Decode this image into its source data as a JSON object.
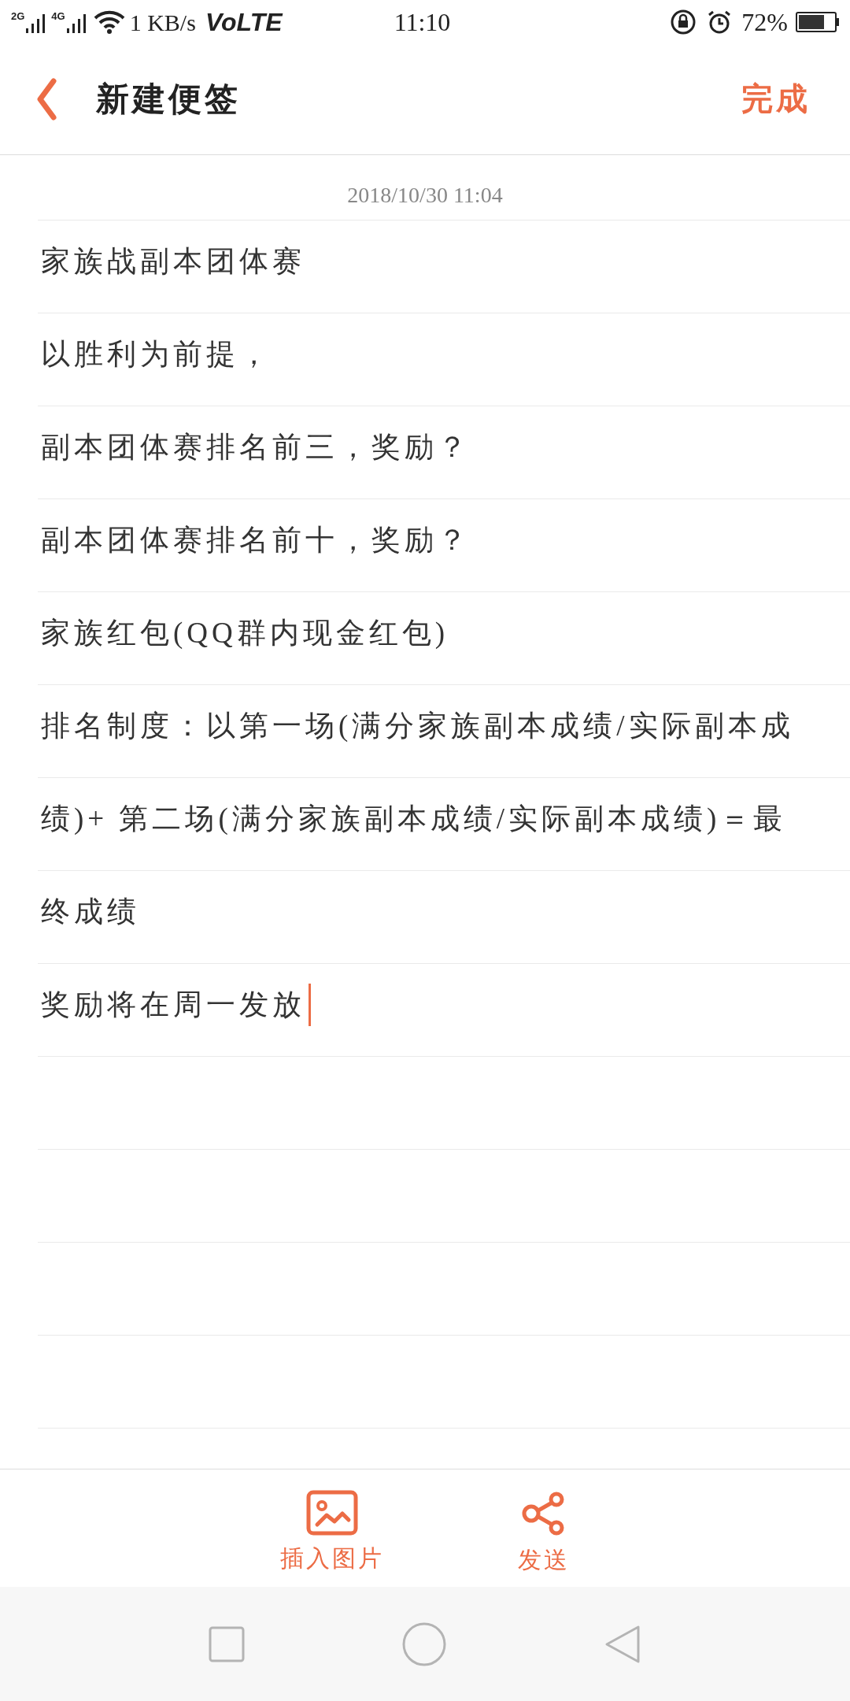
{
  "status_bar": {
    "network_1": "2G",
    "network_2": "4G",
    "speed": "1 KB/s",
    "volte": "VoLTE",
    "time": "11:10",
    "battery": "72%"
  },
  "header": {
    "title": "新建便签",
    "done": "完成"
  },
  "note": {
    "date": "2018/10/30 11:04",
    "lines": [
      {
        "text": "家族战副本团体赛",
        "cursor": false
      },
      {
        "text": "以胜利为前提，",
        "cursor": false
      },
      {
        "text": "副本团体赛排名前三，奖励？",
        "cursor": false
      },
      {
        "text": "副本团体赛排名前十，奖励？",
        "cursor": false
      },
      {
        "text": "家族红包(QQ群内现金红包)",
        "cursor": false
      },
      {
        "text": "排名制度：以第一场(满分家族副本成绩/实际副本成",
        "cursor": false
      },
      {
        "text": "绩)+ 第二场(满分家族副本成绩/实际副本成绩)＝最",
        "cursor": false
      },
      {
        "text": "终成绩",
        "cursor": false
      },
      {
        "text": "奖励将在周一发放",
        "cursor": true
      }
    ]
  },
  "toolbar": [
    {
      "kind": "image",
      "label": "插入图片"
    },
    {
      "kind": "share",
      "label": "发送"
    }
  ]
}
